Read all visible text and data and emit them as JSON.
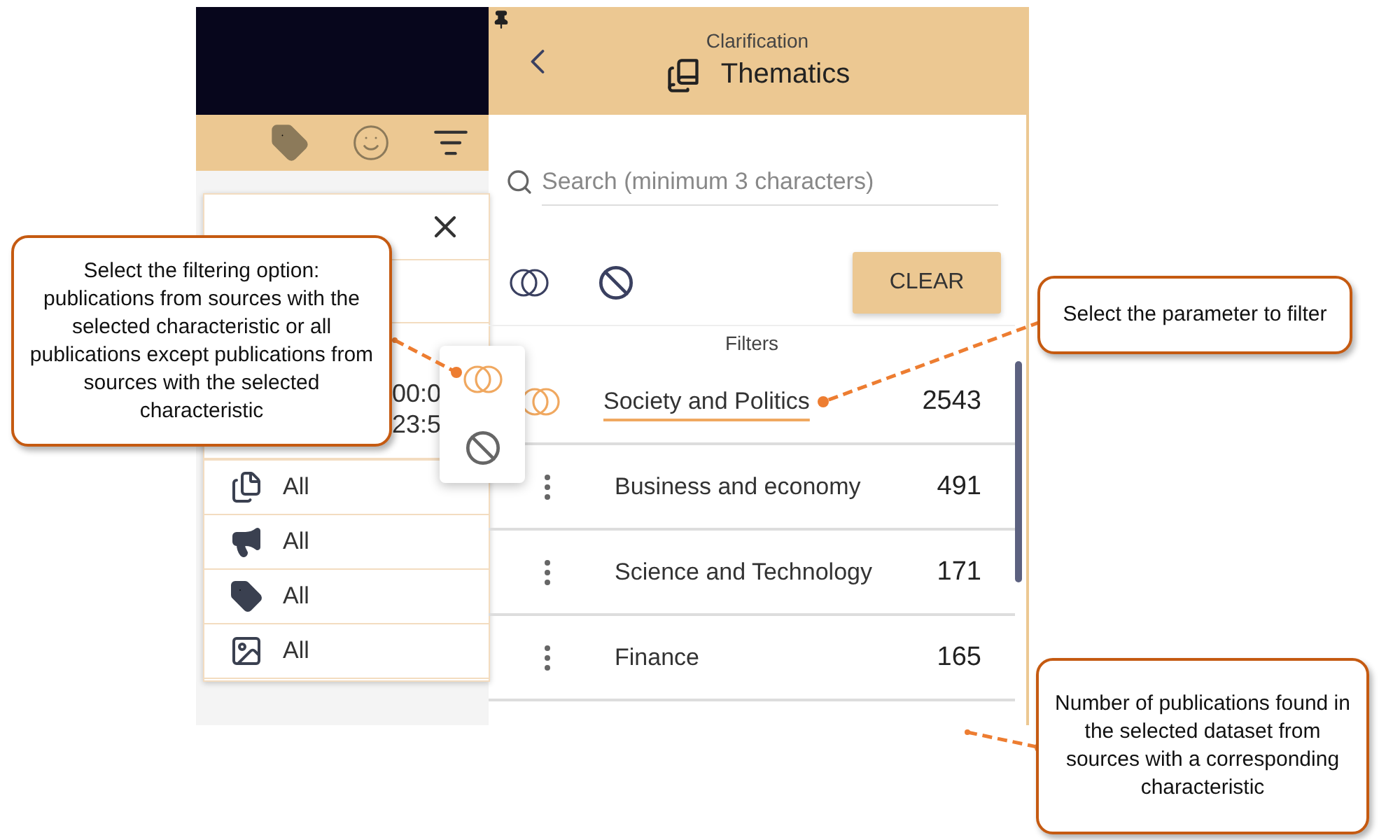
{
  "filter_card": {
    "date_range": {
      "start": "00:0",
      "end": "23:5"
    },
    "filters": [
      {
        "kind": "document",
        "value": "All"
      },
      {
        "kind": "megaphone",
        "value": "All"
      },
      {
        "kind": "tag",
        "value": "All"
      },
      {
        "kind": "image",
        "value": "All"
      }
    ]
  },
  "option_menu": [
    {
      "kind": "include",
      "selected": true
    },
    {
      "kind": "exclude",
      "selected": false
    }
  ],
  "panel": {
    "subtitle": "Clarification",
    "title": "Thematics",
    "search": {
      "placeholder": "Search (minimum 3 characters)"
    },
    "modes": [
      {
        "kind": "include"
      },
      {
        "kind": "exclude"
      }
    ],
    "clear_button": "CLEAR",
    "section_label": "Filters",
    "items": [
      {
        "label": "Society and Politics",
        "count": "2543",
        "selected": true
      },
      {
        "label": "Business and economy",
        "count": "491",
        "selected": false
      },
      {
        "label": "Science and Technology",
        "count": "171",
        "selected": false
      },
      {
        "label": "Finance",
        "count": "165",
        "selected": false
      }
    ]
  },
  "callouts": [
    {
      "text": "Select the filtering option: publications from sources with the selected characteristic or all publications except publications from sources with the selected characteristic"
    },
    {
      "text": "Select the parameter to filter"
    },
    {
      "text": "Number of publications found in the selected dataset from sources with a corresponding characteristic"
    }
  ]
}
